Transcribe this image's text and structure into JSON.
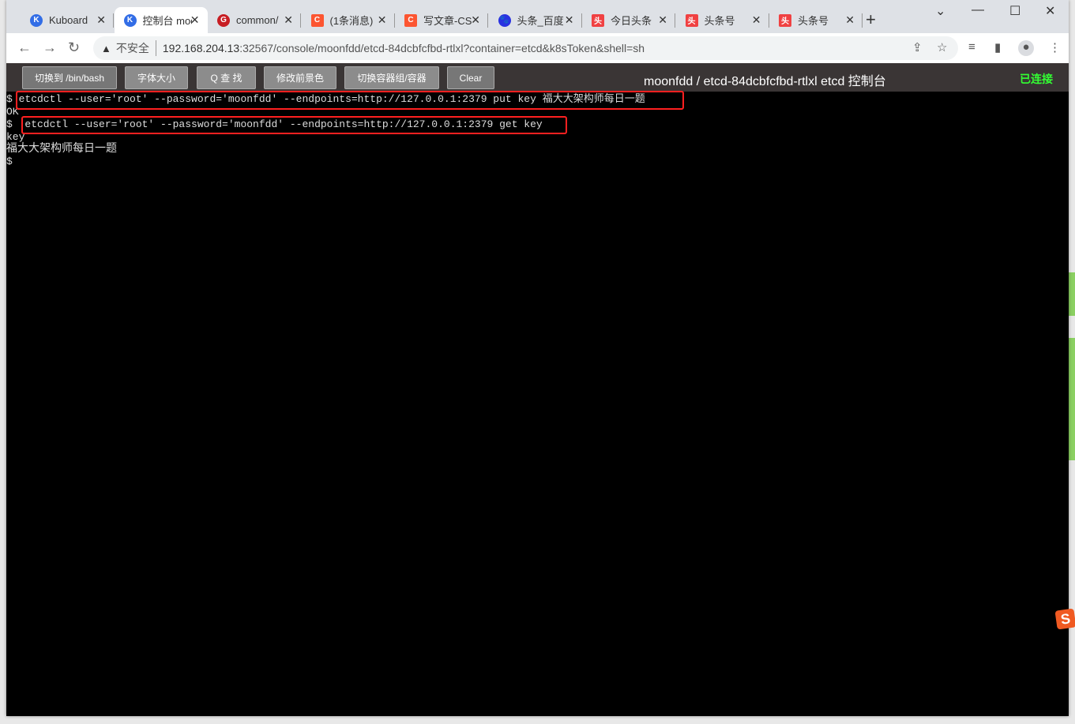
{
  "browser": {
    "tabs": [
      {
        "label": "Kuboard",
        "icon": "kuboard-icon",
        "color": "#326de6",
        "glyph": "K"
      },
      {
        "label": "控制台 moonfdd",
        "icon": "kuboard-icon",
        "color": "#326de6",
        "glyph": "K",
        "active": true
      },
      {
        "label": "common/",
        "icon": "gitee-icon",
        "color": "#c71d23",
        "glyph": "G"
      },
      {
        "label": "(1条消息)",
        "icon": "csdn-icon",
        "color": "#fc5531",
        "glyph": "C"
      },
      {
        "label": "写文章-CSDN",
        "icon": "csdn-icon",
        "color": "#fc5531",
        "glyph": "C"
      },
      {
        "label": "头条_百度",
        "icon": "baidu-icon",
        "color": "#2932e1",
        "glyph": "🐾"
      },
      {
        "label": "今日头条",
        "icon": "toutiao-icon",
        "color": "#f04142",
        "glyph": "头"
      },
      {
        "label": "头条号",
        "icon": "toutiao-icon",
        "color": "#f04142",
        "glyph": "头"
      },
      {
        "label": "头条号",
        "icon": "toutiao-icon",
        "color": "#f04142",
        "glyph": "头"
      }
    ],
    "security": "不安全",
    "url_host": "192.168.204.13",
    "url_rest": ":32567/console/moonfdd/etcd-84dcbfcfbd-rtlxl?container=etcd&k8sToken&shell=sh"
  },
  "toolbar": {
    "buttons": [
      "切换到 /bin/bash",
      "字体大小",
      "Q 查 找",
      "修改前景色",
      "切换容器组/容器",
      "Clear"
    ],
    "title": "moonfdd / etcd-84dcbfcfbd-rtlxl etcd 控制台",
    "status": "已连接",
    "status_color": "#33ff33"
  },
  "terminal": {
    "lines": [
      "$ etcdctl --user='root' --password='moonfdd' --endpoints=http://127.0.0.1:2379 put key 福大大架构师每日一题",
      "OK",
      "$  etcdctl --user='root' --password='moonfdd' --endpoints=http://127.0.0.1:2379 get key",
      "key",
      "福大大架构师每日一题",
      "$"
    ]
  }
}
